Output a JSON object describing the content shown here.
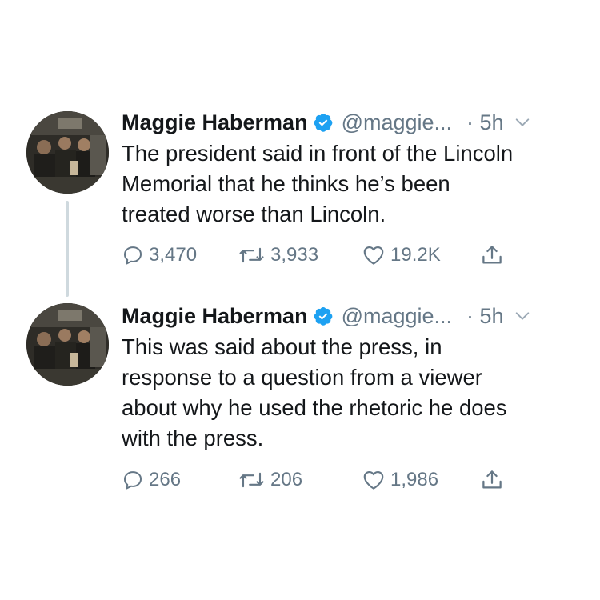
{
  "thread": {
    "tweets": [
      {
        "author_name": "Maggie Haberman",
        "handle": "@maggie...",
        "time": "· 5h",
        "text_lines": [
          "The president said in front of the Lincoln",
          "Memorial that he thinks he’s been",
          "treated worse than Lincoln."
        ],
        "replies": "3,470",
        "retweets": "3,933",
        "likes": "19.2K"
      },
      {
        "author_name": "Maggie Haberman",
        "handle": "@maggie...",
        "time": "· 5h",
        "text_lines": [
          "This was said about the press, in",
          "response to a question from a viewer",
          "about why he used the rhetoric he does",
          "with the press."
        ],
        "replies": "266",
        "retweets": "206",
        "likes": "1,986"
      }
    ]
  },
  "icons": {
    "verified": "verified-badge-icon",
    "caret": "chevron-down-icon",
    "reply": "reply-icon",
    "retweet": "retweet-icon",
    "like": "heart-icon",
    "share": "share-icon"
  },
  "colors": {
    "text": "#14171a",
    "secondary": "#657786",
    "verified": "#1da1f2",
    "thread_line": "#cfd9de"
  }
}
